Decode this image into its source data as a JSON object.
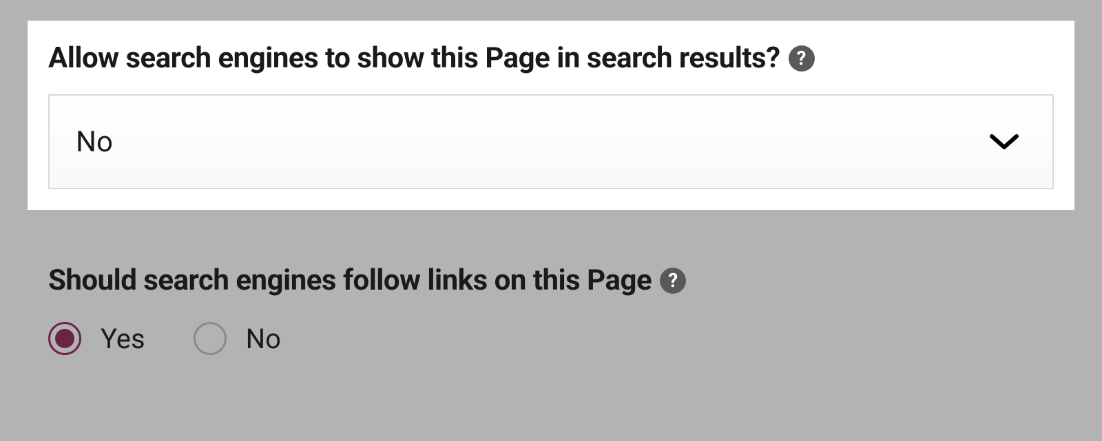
{
  "settings": {
    "allow_search": {
      "label": "Allow search engines to show this Page in search results?",
      "selected": "No"
    },
    "follow_links": {
      "label": "Should search engines follow links on this Page",
      "options": {
        "yes": "Yes",
        "no": "No"
      },
      "selected": "yes"
    }
  },
  "colors": {
    "accent": "#6b2348",
    "help_icon_bg": "#595959"
  }
}
